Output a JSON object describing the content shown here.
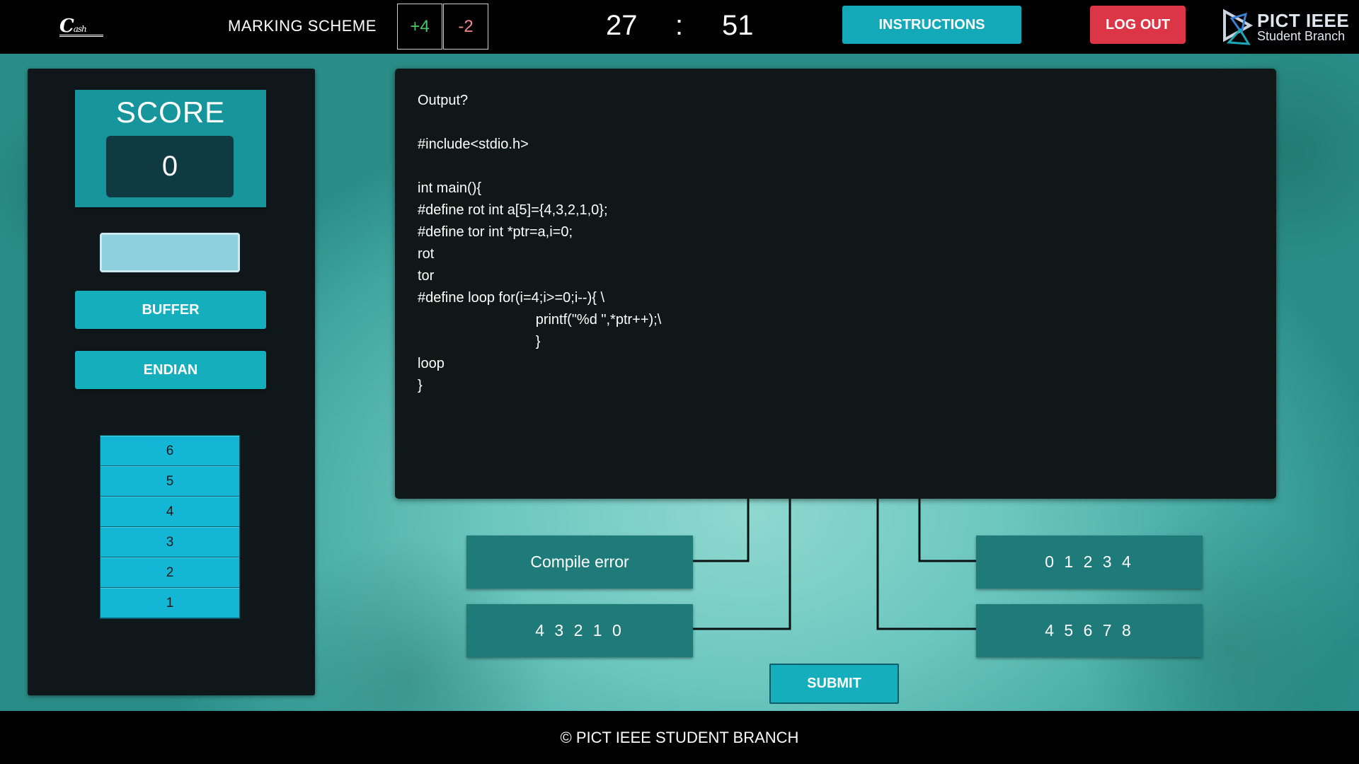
{
  "header": {
    "logo_text": "C",
    "logo_sub": "ash",
    "marking_label": "MARKING SCHEME",
    "mark_plus": "+4",
    "mark_minus": "-2",
    "timer_minutes": "27",
    "timer_separator": ":",
    "timer_seconds": "51",
    "instructions_label": "INSTRUCTIONS",
    "logout_label": "LOG OUT",
    "org_title": "PICT IEEE",
    "org_subtitle": "Student Branch"
  },
  "sidebar": {
    "score_title": "SCORE",
    "score_value": "0",
    "input_value": "",
    "buffer_label": "BUFFER",
    "endian_label": "ENDIAN",
    "stack": [
      "6",
      "5",
      "4",
      "3",
      "2",
      "1"
    ]
  },
  "question": {
    "code": "Output?\n\n#include<stdio.h>\n\nint main(){\n#define rot int a[5]={4,3,2,1,0};\n#define tor int *ptr=a,i=0;\nrot\ntor\n#define loop for(i=4;i>=0;i--){ \\\n                              printf(\"%d \",*ptr++);\\\n                              }\nloop\n}"
  },
  "options": {
    "a": "Compile error",
    "b": "4 3 2 1 0",
    "c": "0 1 2 3 4",
    "d": "4 5 6 7 8"
  },
  "submit_label": "SUBMIT",
  "footer": "© PICT IEEE STUDENT BRANCH",
  "colors": {
    "accent": "#14aebd",
    "option_bg": "#1f7b79",
    "logout": "#dc3545",
    "panel": "#101817"
  }
}
